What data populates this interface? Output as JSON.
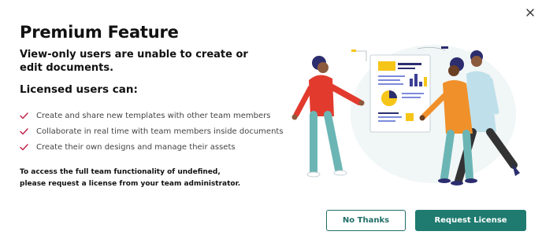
{
  "dialog": {
    "title": "Premium Feature",
    "subtitle": "View-only users are unable to create or edit documents.",
    "list_heading": "Licensed users can:",
    "benefits": [
      "Create and share new templates with other team members",
      "Collaborate in real time with team members inside documents",
      "Create their own designs and manage their assets"
    ],
    "note_line1": "To access the full team functionality of undefined,",
    "note_line2": "please request a license from your team administrator.",
    "close_icon": "close-icon",
    "check_icon": "checkmark-icon"
  },
  "buttons": {
    "secondary_label": "No Thanks",
    "primary_label": "Request License"
  },
  "colors": {
    "accent": "#1f7a6f",
    "check": "#c0264b",
    "title_text": "#111111",
    "body_text": "#444444"
  }
}
